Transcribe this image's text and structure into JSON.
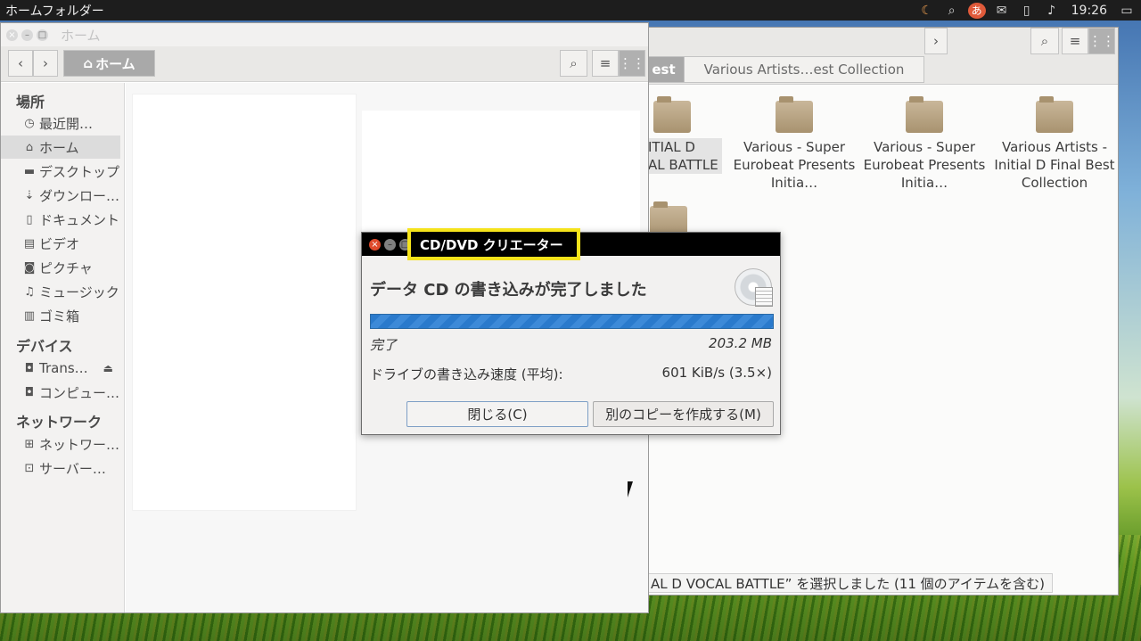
{
  "top_panel": {
    "app_name": "ホームフォルダー",
    "tray_icons": [
      "moon-icon",
      "search-tray-icon",
      "input-method-icon",
      "mail-icon",
      "battery-icon",
      "volume-icon",
      "display-icon"
    ],
    "input_method_glyph": "あ",
    "clock": "19:26"
  },
  "back_window": {
    "breadcrumbs": [
      "est",
      "Various Artists…est Collection"
    ],
    "folders": [
      {
        "label": "ITIAL D\nAL BATTLE"
      },
      {
        "label": "Various - Super Eurobeat Presents Initia…"
      },
      {
        "label": "Various - Super Eurobeat Presents Initia…"
      },
      {
        "label": "Various Artists - Initial D Final Best Collection"
      }
    ],
    "status": "AL D VOCAL BATTLE” を選択しました (11 個のアイテムを含む)"
  },
  "home_window": {
    "title": "ホーム",
    "location_button": "ホーム",
    "sidebar": {
      "places_header": "場所",
      "places": [
        {
          "label": "最近開…",
          "icon": "clock-icon"
        },
        {
          "label": "ホーム",
          "icon": "home-icon",
          "active": true
        },
        {
          "label": "デスクトップ",
          "icon": "folder-icon"
        },
        {
          "label": "ダウンロー…",
          "icon": "download-icon"
        },
        {
          "label": "ドキュメント",
          "icon": "document-icon"
        },
        {
          "label": "ビデオ",
          "icon": "film-icon"
        },
        {
          "label": "ピクチャ",
          "icon": "camera-icon"
        },
        {
          "label": "ミュージック",
          "icon": "music-icon"
        },
        {
          "label": "ゴミ箱",
          "icon": "trash-icon"
        }
      ],
      "devices_header": "デバイス",
      "devices": [
        {
          "label": "Trans…",
          "icon": "drive-icon",
          "eject": true
        },
        {
          "label": "コンピュー…",
          "icon": "drive-icon"
        }
      ],
      "network_header": "ネットワーク",
      "network": [
        {
          "label": "ネットワー…",
          "icon": "network-icon"
        },
        {
          "label": "サーバー…",
          "icon": "server-icon"
        }
      ]
    }
  },
  "dialog": {
    "title": "CD/DVD クリエーター",
    "heading": "データ CD の書き込みが完了しました",
    "progress_fraction": 1.0,
    "status_label": "完了",
    "size": "203.2 MB",
    "speed_label": "ドライブの書き込み速度 (平均):",
    "speed_value": "601 KiB/s (3.5×)",
    "close_button": "閉じる(C)",
    "copy_button": "別のコピーを作成する(M)"
  }
}
